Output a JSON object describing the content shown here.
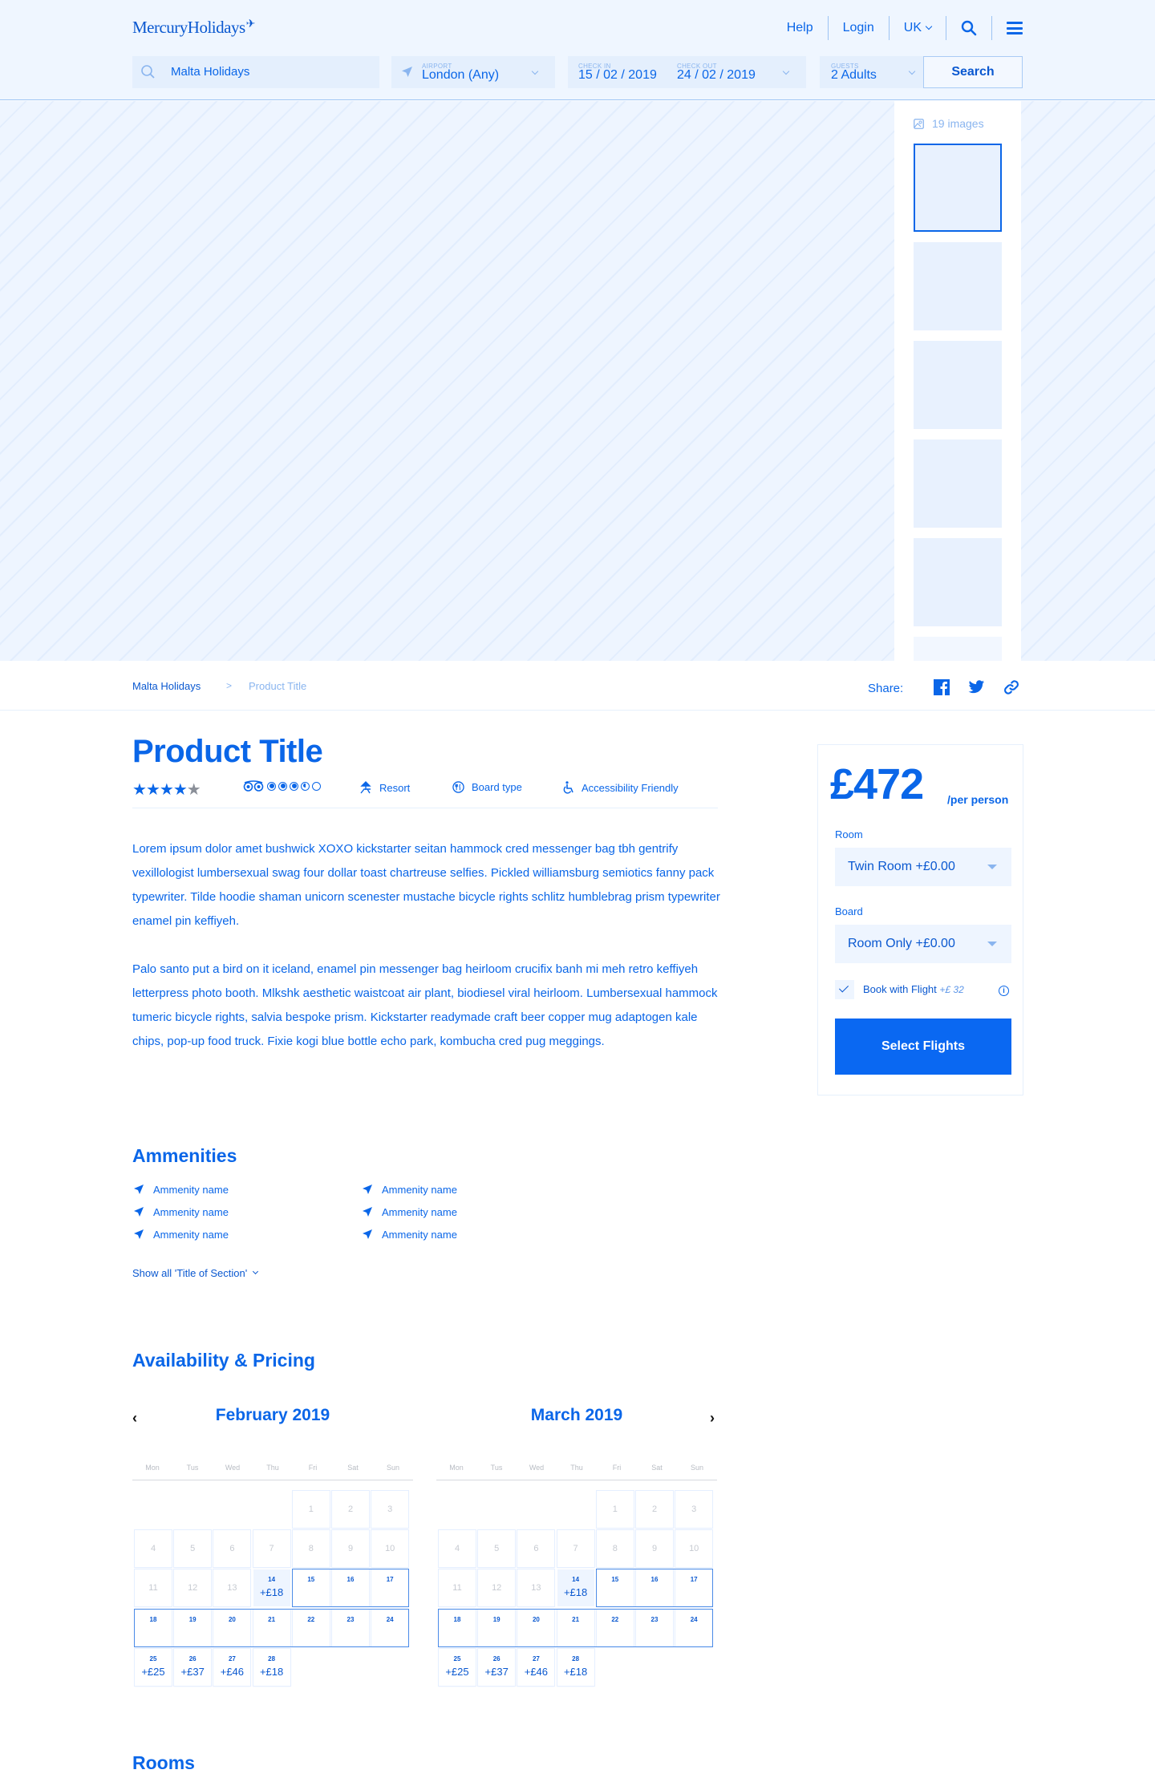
{
  "header": {
    "logo": "MercuryHolidays",
    "nav": {
      "help": "Help",
      "login": "Login",
      "locale": "UK"
    },
    "icons": {
      "search": "search-icon",
      "menu": "hamburger-menu-icon"
    }
  },
  "search": {
    "destination": "Malta Holidays",
    "airport": {
      "label": "AIRPORT",
      "value": "London (Any)"
    },
    "check_in": {
      "label": "CHECK IN",
      "value": "15 / 02 / 2019"
    },
    "check_out": {
      "label": "CHECK OUT",
      "value": "24 / 02 / 2019"
    },
    "guests": {
      "label": "GUESTS",
      "value": "2 Adults"
    },
    "button": "Search"
  },
  "gallery": {
    "image_count": "19 images",
    "thumbnails": 6,
    "active_index": 0
  },
  "breadcrumb": {
    "items": [
      "Malta Holidays",
      "Product Title"
    ],
    "separator": ">"
  },
  "share": {
    "label": "Share:",
    "icons": [
      "facebook-icon",
      "twitter-icon",
      "link-icon"
    ]
  },
  "product": {
    "title": "Product Title",
    "stars": 4,
    "stars_max": 5,
    "tripadvisor_rating": 3.5,
    "tripadvisor_max": 5,
    "tags": [
      "Resort",
      "Board type",
      "Accessibility Friendly"
    ],
    "description": [
      "Lorem ipsum dolor amet bushwick XOXO kickstarter seitan hammock cred messenger bag tbh gentrify vexillologist lumbersexual swag four dollar toast chartreuse selfies. Pickled williamsburg semiotics fanny pack typewriter. Tilde hoodie shaman unicorn scenester mustache bicycle rights schlitz humblebrag prism typewriter enamel pin keffiyeh.",
      "Palo santo put a bird on it iceland, enamel pin messenger bag heirloom crucifix banh mi meh retro keffiyeh letterpress photo booth. Mlkshk aesthetic waistcoat air plant, biodiesel viral heirloom. Lumbersexual hammock tumeric bicycle rights, salvia bespoke prism. Kickstarter readymade craft beer copper mug adaptogen kale chips, pop-up food truck. Fixie kogi blue bottle echo park, kombucha cred pug meggings."
    ]
  },
  "booking": {
    "price": "£472",
    "per": "/per person",
    "room_label": "Room",
    "room_value": "Twin Room  +£0.00",
    "board_label": "Board",
    "board_value": "Room Only +£0.00",
    "flight_checked": true,
    "flight_label": "Book with Flight",
    "flight_extra": "+£ 32",
    "button": "Select Flights"
  },
  "amenities": {
    "title": "Ammenities",
    "items": [
      "Ammenity name",
      "Ammenity name",
      "Ammenity name",
      "Ammenity name",
      "Ammenity name",
      "Ammenity name"
    ],
    "show_all": "Show all 'Title of Section'"
  },
  "availability": {
    "title": "Availability & Pricing",
    "weekdays": [
      "Mon",
      "Tus",
      "Wed",
      "Thu",
      "Fri",
      "Sat",
      "Sun"
    ],
    "months": [
      {
        "name": "February 2019",
        "first_weekday": 4,
        "days": 28,
        "prices": {
          "14": "+£18",
          "25": "+£25",
          "26": "+£37",
          "27": "+£46",
          "28": "+£18"
        },
        "first_available": 14,
        "selected_range": [
          15,
          24
        ]
      },
      {
        "name": "March 2019",
        "first_weekday": 4,
        "days": 28,
        "prices": {
          "14": "+£18",
          "25": "+£25",
          "26": "+£37",
          "27": "+£46",
          "28": "+£18"
        },
        "first_available": 14,
        "selected_range": [
          15,
          24
        ]
      }
    ]
  },
  "rooms": {
    "title": "Rooms"
  },
  "colors": {
    "primary": "#0a66e8",
    "light_bg": "#eff6ff",
    "muted": "#8ab5ef"
  }
}
